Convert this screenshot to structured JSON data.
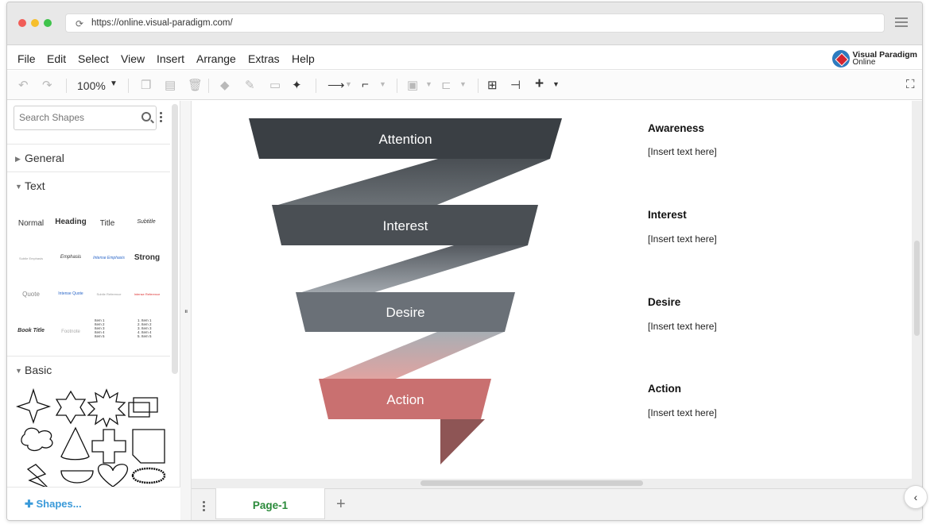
{
  "browser": {
    "url": "https://online.visual-paradigm.com/"
  },
  "menu": {
    "items": [
      "File",
      "Edit",
      "Select",
      "View",
      "Insert",
      "Arrange",
      "Extras",
      "Help"
    ],
    "brand_line1": "Visual Paradigm",
    "brand_line2": "Online"
  },
  "toolbar": {
    "zoom": "100%"
  },
  "sidebar": {
    "search_placeholder": "Search Shapes",
    "sections": {
      "general": "General",
      "text": "Text",
      "basic": "Basic"
    },
    "text_samples": {
      "normal": "Normal",
      "heading": "Heading",
      "title": "Title",
      "subtitle": "Subtitle",
      "subtle_emphasis": "Subtle Emphasis",
      "emphasis": "Emphasis",
      "intense_emphasis": "Intense Emphasis",
      "strong": "Strong",
      "quote": "Quote",
      "intense_quote": "Intense Quote",
      "subtle_reference": "Subtle Reference",
      "intense_reference": "Intense Reference",
      "book_title": "Book Title",
      "footnote": "Footnote",
      "bullet_items": "Item 1\nItem 2\nItem 3\nItem 4\nItem 5",
      "numbered_items": "1. Item 1\n2. Item 2\n3. Item 3\n4. Item 4\n5. Item 5"
    },
    "shapes_link": "Shapes..."
  },
  "diagram": {
    "funnel": [
      {
        "label": "Attention",
        "color": "#3a3f44"
      },
      {
        "label": "Interest",
        "color": "#4a4f54"
      },
      {
        "label": "Desire",
        "color": "#6a7077"
      },
      {
        "label": "Action",
        "color": "#c97070"
      }
    ],
    "stages": [
      {
        "title": "Awareness",
        "text": "[Insert text here]"
      },
      {
        "title": "Interest",
        "text": "[Insert text here]"
      },
      {
        "title": "Desire",
        "text": "[Insert text here]"
      },
      {
        "title": "Action",
        "text": "[Insert text here]"
      }
    ]
  },
  "pages": {
    "tab": "Page-1"
  }
}
